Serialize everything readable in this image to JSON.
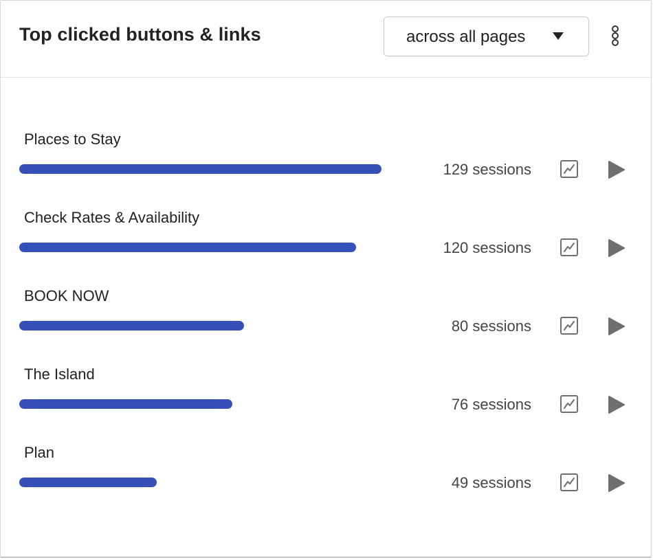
{
  "header": {
    "title": "Top clicked buttons & links",
    "scope_select": {
      "value": "across all pages"
    },
    "icons": {
      "caret": "caret-down-icon",
      "menu": "kebab-menu-icon"
    }
  },
  "rows": [
    {
      "label": "Places to Stay",
      "sessions": 129,
      "sessions_text": "129 sessions"
    },
    {
      "label": "Check Rates & Availability",
      "sessions": 120,
      "sessions_text": "120 sessions"
    },
    {
      "label": "BOOK NOW",
      "sessions": 80,
      "sessions_text": "80 sessions"
    },
    {
      "label": "The Island",
      "sessions": 76,
      "sessions_text": "76 sessions"
    },
    {
      "label": "Plan",
      "sessions": 49,
      "sessions_text": "49 sessions"
    }
  ],
  "row_icons": {
    "trend": "trend-chart-icon",
    "play": "play-icon"
  },
  "colors": {
    "bar": "#3650b8",
    "icon": "#6f6f6f",
    "text": "#222222",
    "muted_text": "#444444"
  }
}
